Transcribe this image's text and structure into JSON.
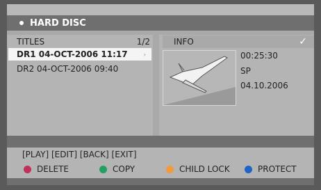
{
  "header": {
    "title": "HARD DISC"
  },
  "titles": {
    "heading": "TITLES",
    "page": "1/2",
    "items": [
      {
        "label": "DR1 04-OCT-2006 11:17"
      },
      {
        "label": "DR2 04-OCT-2006 09:40"
      }
    ]
  },
  "info": {
    "heading": "INFO",
    "check": "✓",
    "duration": "00:25:30",
    "mode": "SP",
    "date": "04.10.2006"
  },
  "footer": {
    "keys": "[PLAY] [EDIT] [BACK] [EXIT]",
    "legend": [
      {
        "label": "DELETE",
        "color": "#c0305a"
      },
      {
        "label": "COPY",
        "color": "#23a060"
      },
      {
        "label": "CHILD LOCK",
        "color": "#f39a3c"
      },
      {
        "label": "PROTECT",
        "color": "#1f63c7"
      }
    ]
  }
}
